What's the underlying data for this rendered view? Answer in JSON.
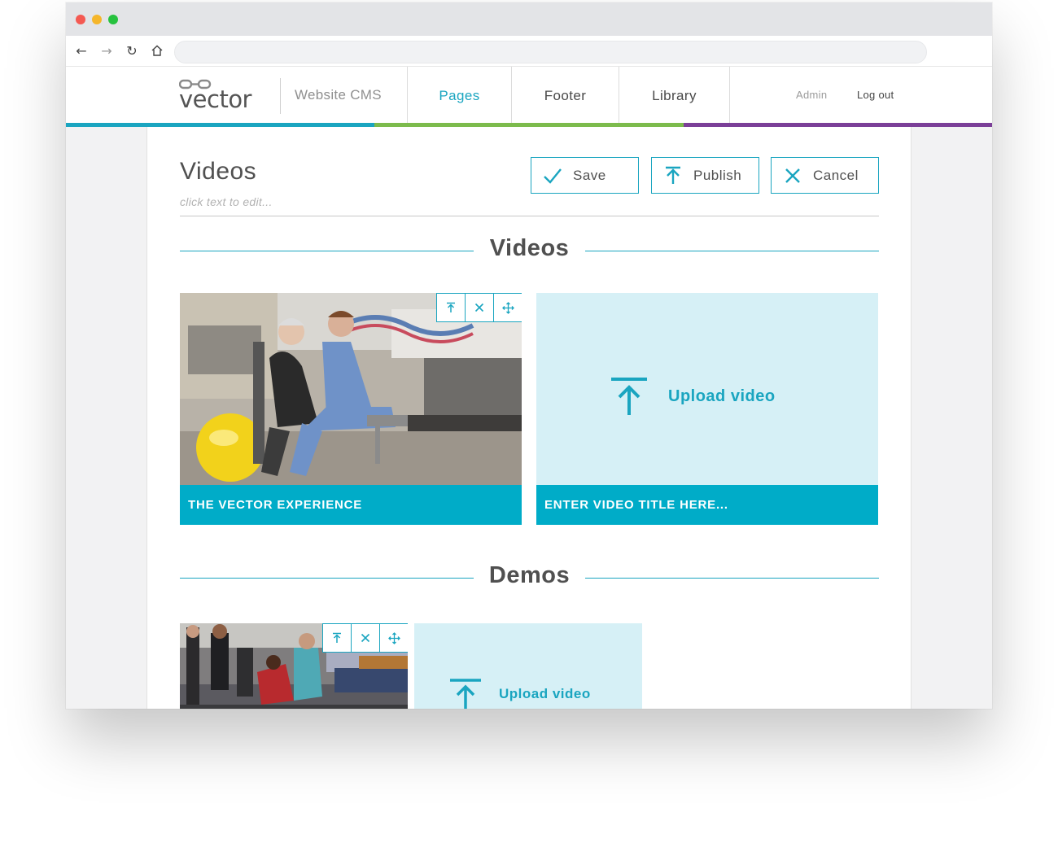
{
  "app": {
    "name": "vector",
    "section_label": "Website CMS",
    "admin_label": "Admin",
    "logout_label": "Log out"
  },
  "nav": {
    "tabs": [
      {
        "label": "Pages",
        "active": true
      },
      {
        "label": "Footer",
        "active": false
      },
      {
        "label": "Library",
        "active": false
      }
    ]
  },
  "colorbar": [
    "#1aa5c0",
    "#7cbb4c",
    "#7b3f98"
  ],
  "page": {
    "title": "Videos",
    "hint": "click text to edit..."
  },
  "actions": {
    "save_label": "Save",
    "publish_label": "Publish",
    "cancel_label": "Cancel"
  },
  "sections": [
    {
      "heading": "Videos",
      "items": [
        {
          "title": "THE VECTOR EXPERIENCE",
          "has_video": true
        },
        {
          "title": "ENTER VIDEO TITLE HERE...",
          "has_video": false,
          "upload_label": "Upload video"
        }
      ]
    },
    {
      "heading": "Demos",
      "items": [
        {
          "title": "",
          "has_video": true
        },
        {
          "title": "",
          "has_video": false,
          "upload_label": "Upload video"
        }
      ]
    }
  ],
  "icons": {
    "save": "checkmark-icon",
    "publish": "upload-arrow-icon",
    "cancel": "close-icon",
    "tile_controls": [
      "replace-icon",
      "delete-icon",
      "move-icon"
    ]
  },
  "accent_color": "#1aa5c0",
  "title_bar_color": "#00acc8"
}
